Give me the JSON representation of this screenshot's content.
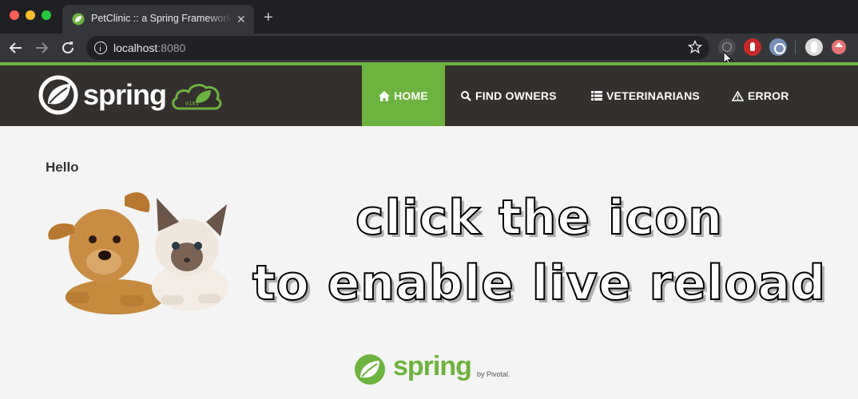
{
  "browser": {
    "tab_title": "PetClinic :: a Spring Framework demonstration",
    "tab_close": "✕",
    "new_tab": "+",
    "url_host": "localhost",
    "url_port": ":8080"
  },
  "navbar": {
    "brand": "spring",
    "items": [
      {
        "label": "HOME",
        "icon": "home-icon",
        "active": true
      },
      {
        "label": "FIND OWNERS",
        "icon": "search-icon",
        "active": false
      },
      {
        "label": "VETERINARIANS",
        "icon": "list-icon",
        "active": false
      },
      {
        "label": "ERROR",
        "icon": "warning-icon",
        "active": false
      }
    ]
  },
  "main": {
    "greeting": "Hello",
    "overlay_lines": [
      "click the icon",
      "to enable live reload"
    ]
  },
  "footer": {
    "brand": "spring",
    "by": "by Pivotal."
  },
  "colors": {
    "brand_green": "#6db33f",
    "navbar_bg": "#34302d",
    "page_bg": "#f4f4f4"
  }
}
